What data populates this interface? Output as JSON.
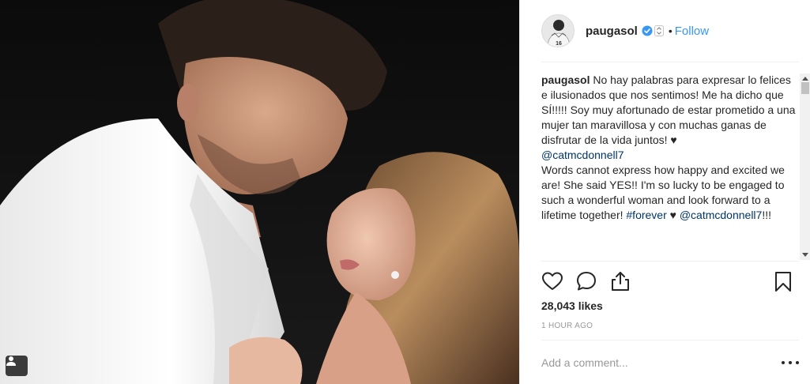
{
  "photo": {
    "alt_subject": "couple-photo",
    "user_tag_icon": "person-tag-icon"
  },
  "header": {
    "username": "paugasol",
    "separator": "•",
    "follow_label": "Follow",
    "avatar_jersey_number": "16",
    "verified_icon": "verified-badge-icon",
    "accent_color": "#3897f0"
  },
  "caption": {
    "author": "paugasol",
    "text_part1": " No hay palabras para expresar lo felices e ilusionados que nos sentimos! Me ha dicho que SÍ!!!!! Soy muy afortunado de estar prometido a una mujer tan maravillosa y con muchas ganas de disfrutar de la vida juntos! ",
    "heart1": "♥",
    "mention1": "@catmcdonnell7",
    "text_part2": "Words cannot express how happy and excited we are! She said YES!! I'm so lucky to be engaged to such a wonderful woman and look forward to a lifetime together! ",
    "hashtag": "#forever",
    "heart2": " ♥ ",
    "mention2": "@catmcdonnell7",
    "suffix": "!!!"
  },
  "actions": {
    "like_icon": "heart-icon",
    "comment_icon": "comment-icon",
    "share_icon": "share-icon",
    "save_icon": "bookmark-icon"
  },
  "likes": "28,043 likes",
  "timestamp": "1 HOUR AGO",
  "comment": {
    "placeholder": "Add a comment...",
    "value": "",
    "more_icon": "more-options-icon"
  }
}
